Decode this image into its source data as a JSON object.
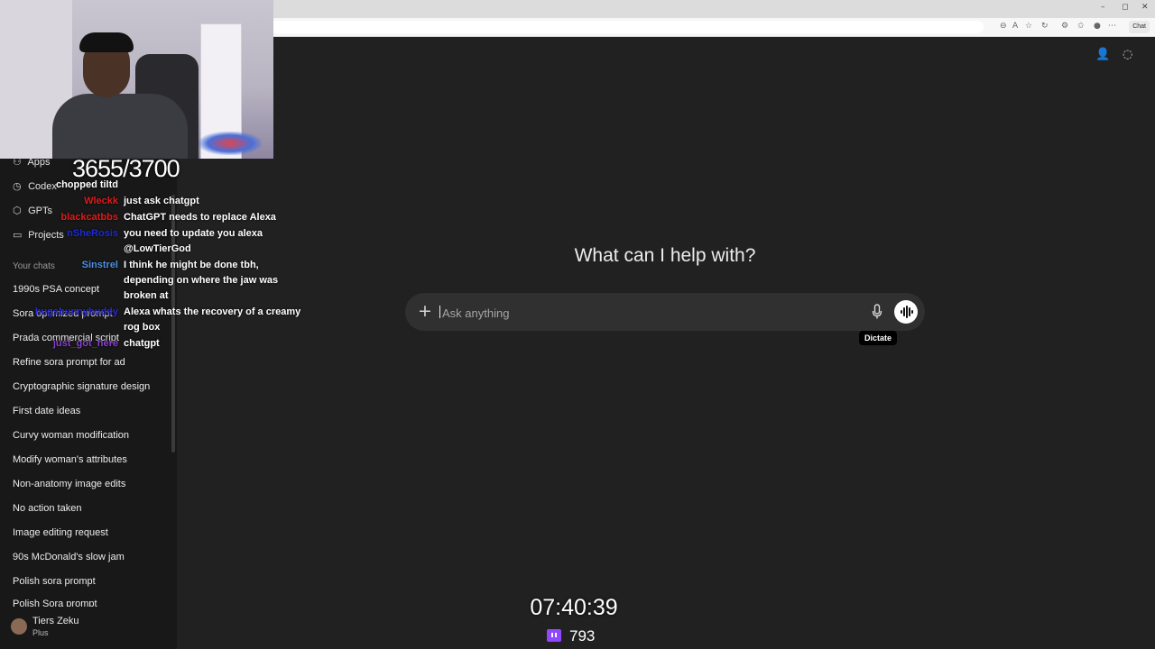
{
  "browser": {
    "window_controls": [
      "–",
      "◻",
      "✕"
    ],
    "copilot_label": "Chat"
  },
  "sidebar": {
    "nav": [
      {
        "label": "Apps",
        "icon": "apps-icon"
      },
      {
        "label": "Codex",
        "icon": "codex-icon"
      },
      {
        "label": "GPTs",
        "icon": "gpts-icon"
      },
      {
        "label": "Projects",
        "icon": "folder-icon"
      }
    ],
    "section_title": "Your chats",
    "chats": [
      "1990s PSA concept",
      "Sora optimized prompt",
      "Prada commercial script",
      "Refine sora prompt for ad",
      "Cryptographic signature design",
      "First date ideas",
      "Curvy woman modification",
      "Modify woman's attributes",
      "Non-anatomy image edits",
      "No action taken",
      "Image editing request",
      "90s McDonald's slow jam",
      "Polish sora prompt",
      "Polish Sora prompt"
    ],
    "user": {
      "name": "Tiers Zeku",
      "plan": "Plus"
    }
  },
  "main": {
    "heading": "What can I help with?",
    "composer": {
      "placeholder": "Ask anything"
    },
    "tooltip": "Dictate"
  },
  "overlay": {
    "counter": "3655/3700",
    "chat": [
      {
        "user": "chopped tiltd",
        "color": "#ffffff",
        "message": ""
      },
      {
        "user": "Wleckk",
        "color": "#e01b1b",
        "message": "just ask chatgpt"
      },
      {
        "user": "blackcatbbs",
        "color": "#e01b1b",
        "message": "ChatGPT needs to replace Alexa"
      },
      {
        "user": "nSheRosis",
        "color": "#1f2ad6",
        "message": "you need to update you alexa"
      },
      {
        "user": "",
        "color": "#ffffff",
        "message": "@LowTierGod"
      },
      {
        "user": "Sinstrel",
        "color": "#4f8fe0",
        "message": "I think he might be done tbh,"
      },
      {
        "user": "",
        "color": "#ffffff",
        "message": "depending on where the jaw was"
      },
      {
        "user": "",
        "color": "#ffffff",
        "message": "broken at"
      },
      {
        "user": "bugsbunnybuddy",
        "color": "#2a2ad8",
        "message": "Alexa whats the recovery of a creamy"
      },
      {
        "user": "",
        "color": "#ffffff",
        "message": "rog box"
      },
      {
        "user": "just_got_here",
        "color": "#8a3fd1",
        "message": "chatgpt"
      }
    ],
    "timer": "07:40:39",
    "viewers": "793",
    "accent": "#9146ff"
  }
}
